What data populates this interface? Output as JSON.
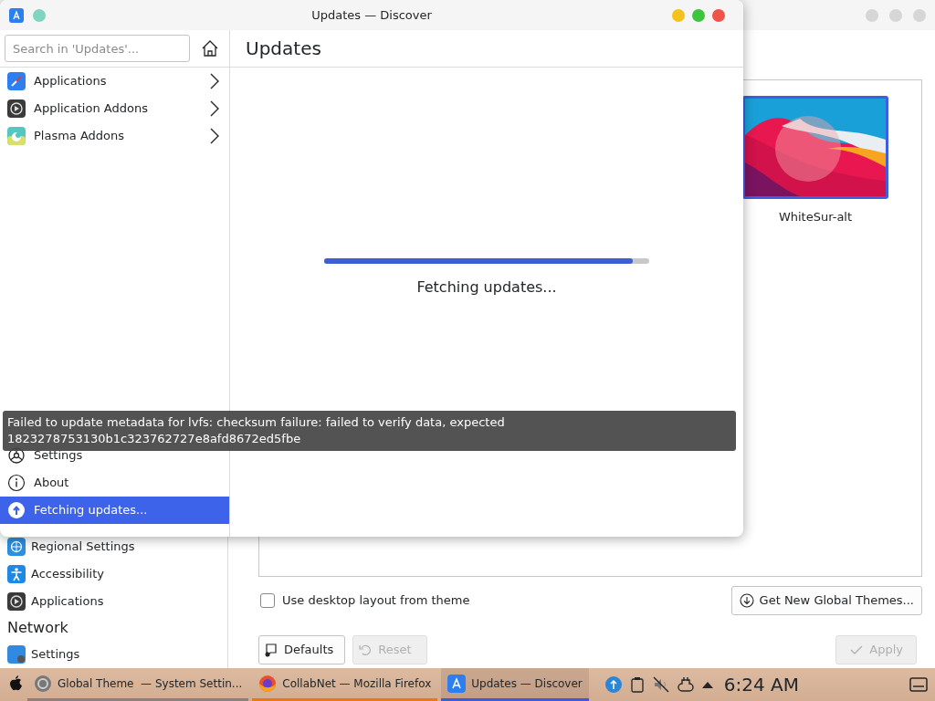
{
  "settings_window": {
    "theme_card": {
      "name": "WhiteSur-alt",
      "selected": true
    },
    "sidebar": [
      {
        "label": "Regional Settings",
        "kind": "globe"
      },
      {
        "label": "Accessibility",
        "kind": "person"
      },
      {
        "label": "Applications",
        "kind": "apps"
      },
      {
        "label": "Network",
        "kind": "header"
      },
      {
        "label": "Settings",
        "kind": "network"
      }
    ],
    "use_layout": {
      "label": "Use desktop layout from theme",
      "checked": false
    },
    "get_new": "Get New Global Themes...",
    "buttons": [
      {
        "label": "Defaults",
        "kind": "defaults",
        "disabled": false
      },
      {
        "label": "Reset",
        "kind": "reset",
        "disabled": true
      },
      {
        "label": "Apply",
        "kind": "apply",
        "disabled": true
      }
    ]
  },
  "discover_window": {
    "title": "Updates — Discover",
    "search": {
      "placeholder": "Search in 'Updates'..."
    },
    "categories": [
      {
        "label": "Applications",
        "kind": "compass"
      },
      {
        "label": "Application Addons",
        "kind": "addons"
      },
      {
        "label": "Plasma Addons",
        "kind": "plasma"
      }
    ],
    "actions": [
      {
        "label": "Settings",
        "kind": "settings",
        "selected": false
      },
      {
        "label": "About",
        "kind": "about",
        "selected": false
      },
      {
        "label": "Fetching updates...",
        "kind": "update",
        "selected": true
      }
    ],
    "heading": "Updates",
    "progress": {
      "level": 0.95
    },
    "status": "Fetching updates..."
  },
  "tooltip": {
    "lines": [
      "Failed to update metadata for lvfs: checksum failure: failed to verify data, expected",
      "1823278753130b1c323762727e8afd8672ed5fbe"
    ]
  },
  "taskbar": {
    "tasks": [
      {
        "label": "Global Theme  — System Settin...",
        "kind": "settings",
        "color": "#8c8278",
        "selected": false
      },
      {
        "label": "CollabNet — Mozilla Firefox",
        "kind": "browser",
        "color": "#e8781e",
        "selected": false
      },
      {
        "label": "Updates — Discover",
        "kind": "store",
        "color": "#3b5bdb",
        "selected": true
      }
    ],
    "clock": "6:24 AM"
  }
}
